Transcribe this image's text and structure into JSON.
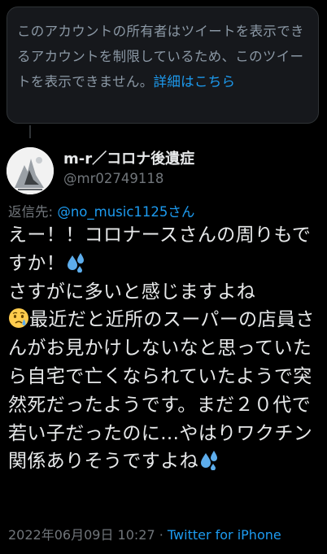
{
  "notice": {
    "text": "このアカウントの所有者はツイートを表示できるアカウントを制限しているため、このツイートを表示できません。",
    "link": "詳細はこちら"
  },
  "tweet": {
    "display_name": "m-r／コロナ後遺症",
    "handle": "@mr02749118",
    "reply_prefix": "返信先: ",
    "reply_to": "@no_music1125さん",
    "body": {
      "part1": "えー！！コロナースさんの周りもですか！",
      "part2": "さすがに多いと感じますよね",
      "part3": "最近だと近所のスーパーの店員さんがお見かけしないなと思っていたら自宅で亡くなられていたようで突然死だったようです。まだ２０代で若い子だったのに...やはりワクチン関係ありそうですよね"
    },
    "timestamp": "2022年06月09日 10:27",
    "separator": " · ",
    "source": "Twitter for iPhone"
  },
  "icons": {
    "sweat": "sweat-droplets-icon",
    "crying": "crying-face-icon"
  },
  "colors": {
    "background": "#000000",
    "notice_bg": "#16181c",
    "link": "#1d9bf0",
    "muted": "#71767b",
    "text": "#e7e9ea"
  }
}
